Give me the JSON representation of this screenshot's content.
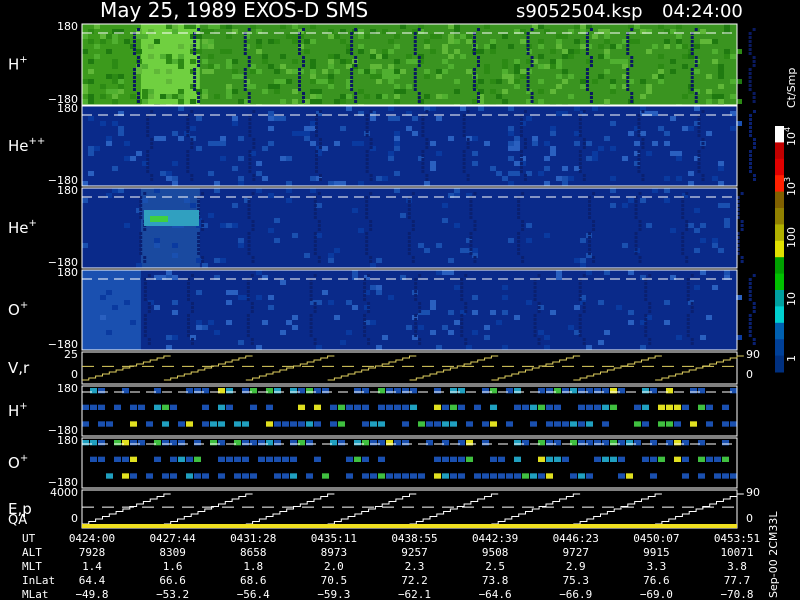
{
  "header": {
    "title": "May 25, 1989   EXOS-D SMS",
    "file": "s9052504.ksp",
    "time": "04:24:00"
  },
  "colorbar": {
    "unit": "Ct/Smp",
    "ticks": [
      "10",
      "10",
      "100",
      "10",
      "1"
    ],
    "exponents": [
      "4",
      "3"
    ],
    "colors": [
      "#ffffff",
      "#c00000",
      "#e00000",
      "#ff2000",
      "#806000",
      "#908000",
      "#b0b000",
      "#e0e000",
      "#00a000",
      "#00c000",
      "#00a0a0",
      "#00d0d0",
      "#0060b0",
      "#004098",
      "#003080"
    ]
  },
  "chart_data": {
    "type": "heatmap",
    "xlim": [
      "04:24:00",
      "04:53:51"
    ],
    "panels": [
      {
        "label": "H",
        "superscript": "+",
        "ytop": "180",
        "ybot": "−180",
        "kind": "spectrogram",
        "dominant_color": "#40a020"
      },
      {
        "label": "He",
        "superscript": "++",
        "ytop": "180",
        "ybot": "−180",
        "kind": "spectrogram",
        "dominant_color": "#0a2a8a"
      },
      {
        "label": "He",
        "superscript": "+",
        "ytop": "180",
        "ybot": "−180",
        "kind": "spectrogram",
        "dominant_color": "#0a2a8a"
      },
      {
        "label": "O",
        "superscript": "+",
        "ytop": "180",
        "ybot": "−180",
        "kind": "spectrogram",
        "dominant_color": "#0a2a8a"
      },
      {
        "label": "V,r",
        "superscript": "",
        "ytop": "25",
        "ymid": "0",
        "right_top": "90",
        "right_bot": "0",
        "kind": "sweep"
      },
      {
        "label": "H",
        "superscript": "+",
        "ytop": "180",
        "ybot": "−180",
        "kind": "blocks"
      },
      {
        "label": "O",
        "superscript": "+",
        "ytop": "180",
        "ybot": "−180",
        "kind": "blocks"
      },
      {
        "label": "E,p",
        "label2": "QA",
        "superscript": "",
        "ytop": "4000",
        "ymid": "0",
        "right_top": "90",
        "right_bot": "0",
        "kind": "sweep_qa"
      }
    ],
    "table": {
      "row_labels": [
        "UT",
        "ALT",
        "MLT",
        "InLat",
        "MLat"
      ],
      "rows": [
        [
          "0424:00",
          "0427:44",
          "0431:28",
          "0435:11",
          "0438:55",
          "0442:39",
          "0446:23",
          "0450:07",
          "0453:51"
        ],
        [
          "7928",
          "8309",
          "8658",
          "8973",
          "9257",
          "9508",
          "9727",
          "9915",
          "10071"
        ],
        [
          "1.4",
          "1.6",
          "1.8",
          "2.0",
          "2.3",
          "2.5",
          "2.9",
          "3.3",
          "3.8"
        ],
        [
          "64.4",
          "66.6",
          "68.6",
          "70.5",
          "72.2",
          "73.8",
          "75.3",
          "76.6",
          "77.7"
        ],
        [
          "−49.8",
          "−53.2",
          "−56.4",
          "−59.3",
          "−62.1",
          "−64.6",
          "−66.9",
          "−69.0",
          "−70.8"
        ]
      ]
    }
  },
  "footer": {
    "stamp": "Sep-00 2CM33L"
  }
}
